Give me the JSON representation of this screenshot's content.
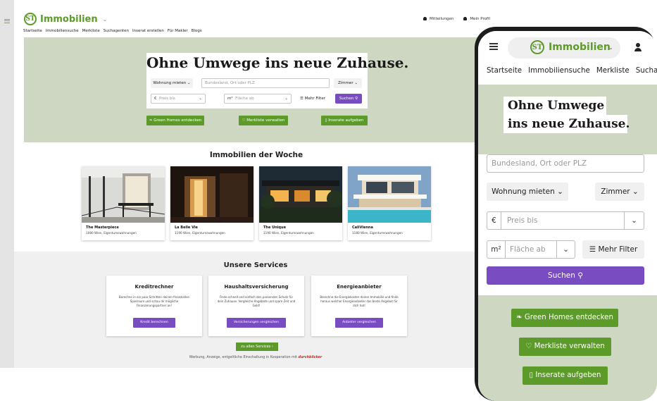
{
  "brand": {
    "logo_mark": "ST",
    "name": "Immobilien",
    "green": "#5c9a2a",
    "purple": "#7a4cc2",
    "hero_bg": "#cdd7c1"
  },
  "desktop": {
    "nav": [
      "Startseite",
      "Immobiliensuche",
      "Merkliste",
      "Suchagenten",
      "Inserat erstellen",
      "Für Makler",
      "Blogs"
    ],
    "notifications": "Mitteilungen",
    "profile": "Mein Profil",
    "hero_title": "Ohne Umwege ins neue Zuhause.",
    "search": {
      "type": "Wohnung mieten",
      "location_placeholder": "Bundesland, Ort oder PLZ",
      "rooms": "Zimmer",
      "currency": "€",
      "price_placeholder": "Preis bis",
      "area_unit": "m²",
      "area_placeholder": "Fläche ab",
      "more_filters": "Mehr Filter",
      "submit": "Suchen"
    },
    "actions": [
      "Green Homes entdecken",
      "Merkliste verwalten",
      "Inserate aufgeben"
    ],
    "week_heading": "Immobilien der Woche",
    "listings": [
      {
        "title": "The Masterpiece",
        "subtitle": "1080 Wien, Eigentumswohnungen"
      },
      {
        "title": "La Belle Vie",
        "subtitle": "1190 Wien, Eigentumswohnungen"
      },
      {
        "title": "The Unique",
        "subtitle": "1190 Wien, Eigentumswohnungen"
      },
      {
        "title": "CaliVienna",
        "subtitle": "1180 Wien, Eigentumswohnungen"
      }
    ],
    "services_heading": "Unsere Services",
    "services": [
      {
        "title": "Kreditrechner",
        "text": "Berechne in ein paar Schritten deinen finanziellen Spielraum und schau dir mögliche Finanzierungspartner an!",
        "button": "Kredit berechnen"
      },
      {
        "title": "Haushaltsversicherung",
        "text": "Finde schnell und einfach den passenden Schutz für dein Zuhause. Vergleiche Angebote und spare Zeit und Geld!",
        "button": "Versicherungen vergleichen"
      },
      {
        "title": "Energieanbieter",
        "text": "Berechne die Energiekosten deiner Immobilie und finde heraus welcher Energieanbieter das beste Angebot für dich hat!",
        "button": "Anbieter vergleichen"
      }
    ],
    "all_services": "zu allen Services",
    "footer_text": "Werbung, Anzeige, entgeltliche Einschaltung in Kooperation mit",
    "footer_partner": "durchblicker"
  },
  "mobile": {
    "nav": [
      "Startseite",
      "Immobiliensuche",
      "Merkliste",
      "Suchage"
    ],
    "title_line1": "Ohne Umwege",
    "title_line2": "ins neue Zuhause.",
    "location_placeholder": "Bundesland, Ort oder PLZ",
    "type": "Wohnung mieten",
    "rooms": "Zimmer",
    "currency": "€",
    "price_placeholder": "Preis bis",
    "area_unit": "m²",
    "area_placeholder": "Fläche ab",
    "more_filters": "Mehr Filter",
    "submit": "Suchen",
    "actions": [
      "Green Homes entdecken",
      "Merkliste verwalten",
      "Inserate aufgeben"
    ]
  }
}
